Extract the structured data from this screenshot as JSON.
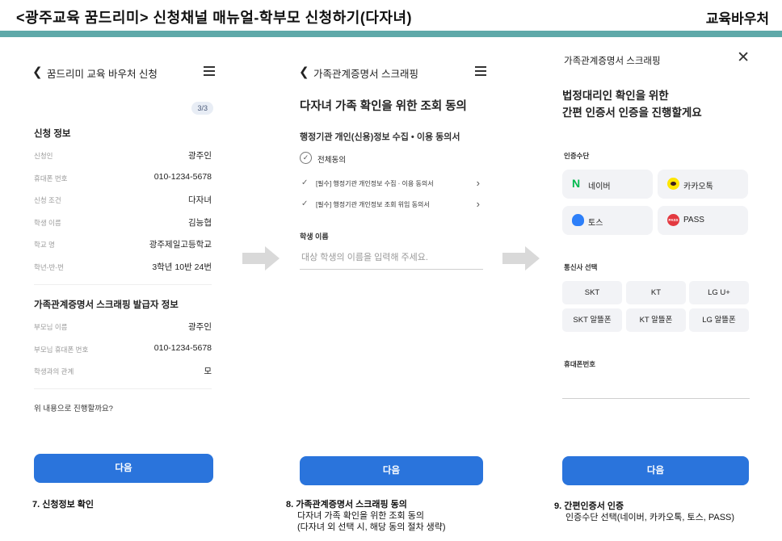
{
  "header": {
    "title": "<광주교육 꿈드리미> 신청채널 매뉴얼-학부모 신청하기(다자녀)",
    "badge": "교육바우처"
  },
  "screen1": {
    "nav_title": "꿈드리미 교육 바우처 신청",
    "step": "3/3",
    "section1_title": "신청 정보",
    "rows": [
      {
        "label": "신청인",
        "value": "광주인"
      },
      {
        "label": "휴대폰 번호",
        "value": "010-1234-5678"
      },
      {
        "label": "신청 조건",
        "value": "다자녀"
      },
      {
        "label": "학생 이름",
        "value": "김능협"
      },
      {
        "label": "학교 명",
        "value": "광주제일고등학교"
      },
      {
        "label": "학년-반-번",
        "value": "3학년 10반 24번"
      }
    ],
    "section2_title": "가족관계증명서 스크래핑 발급자 정보",
    "rows2": [
      {
        "label": "부모님 이름",
        "value": "광주인"
      },
      {
        "label": "부모님 휴대폰 번호",
        "value": "010-1234-5678"
      },
      {
        "label": "학생과의 관계",
        "value": "모"
      }
    ],
    "confirm_question": "위 내용으로 진행할까요?",
    "next_label": "다음"
  },
  "screen2": {
    "nav_title": "가족관계증명서 스크래핑",
    "heading": "다자녀 가족 확인을 위한 조회 동의",
    "consent_title": "행정기관 개인(신용)정보 수집 • 이용 동의서",
    "agree_all": "전체동의",
    "agree_items": [
      "[필수] 행정기관 개인정보 수집 · 이용 동의서",
      "[필수] 행정기관 개인정보 조회 위임 동의서"
    ],
    "student_name_label": "학생 이름",
    "student_name_placeholder": "대상 학생의 이름을 입력해 주세요.",
    "next_label": "다음"
  },
  "screen3": {
    "title": "가족관계증명서 스크래핑",
    "heading_line1": "법정대리인 확인을 위한",
    "heading_line2": "간편 인증서 인증을 진행할게요",
    "auth_label": "인증수단",
    "auth_methods": [
      {
        "label": "네이버",
        "icon": "naver-icon"
      },
      {
        "label": "카카오톡",
        "icon": "kakaotalk-icon"
      },
      {
        "label": "토스",
        "icon": "toss-icon"
      },
      {
        "label": "PASS",
        "icon": "pass-icon"
      }
    ],
    "pass_icon_text": "PASS",
    "naver_icon_text": "N",
    "carrier_label": "통신사 선택",
    "carriers": [
      "SKT",
      "KT",
      "LG U+",
      "SKT 알뜰폰",
      "KT 알뜰폰",
      "LG 알뜰폰"
    ],
    "phone_label": "휴대폰번호",
    "next_label": "다음"
  },
  "captions": [
    {
      "title": "7. 신청정보 확인",
      "lines": []
    },
    {
      "title": "8. 가족관계증명서 스크래핑 동의",
      "lines": [
        "다자녀 가족 확인을 위한 조회 동의",
        "(다자녀 외 선택 시, 해당 동의 절차 생략)"
      ]
    },
    {
      "title": "9. 간편인증서 인증",
      "lines": [
        "인증수단 선택(네이버, 카카오톡, 토스, PASS)"
      ]
    }
  ],
  "colors": {
    "accent_bar": "#5fa9a9",
    "primary_button": "#2a74dc",
    "naver": "#03b94f",
    "kakao": "#fee500",
    "toss": "#2d7ff9",
    "pass": "#e33940"
  }
}
